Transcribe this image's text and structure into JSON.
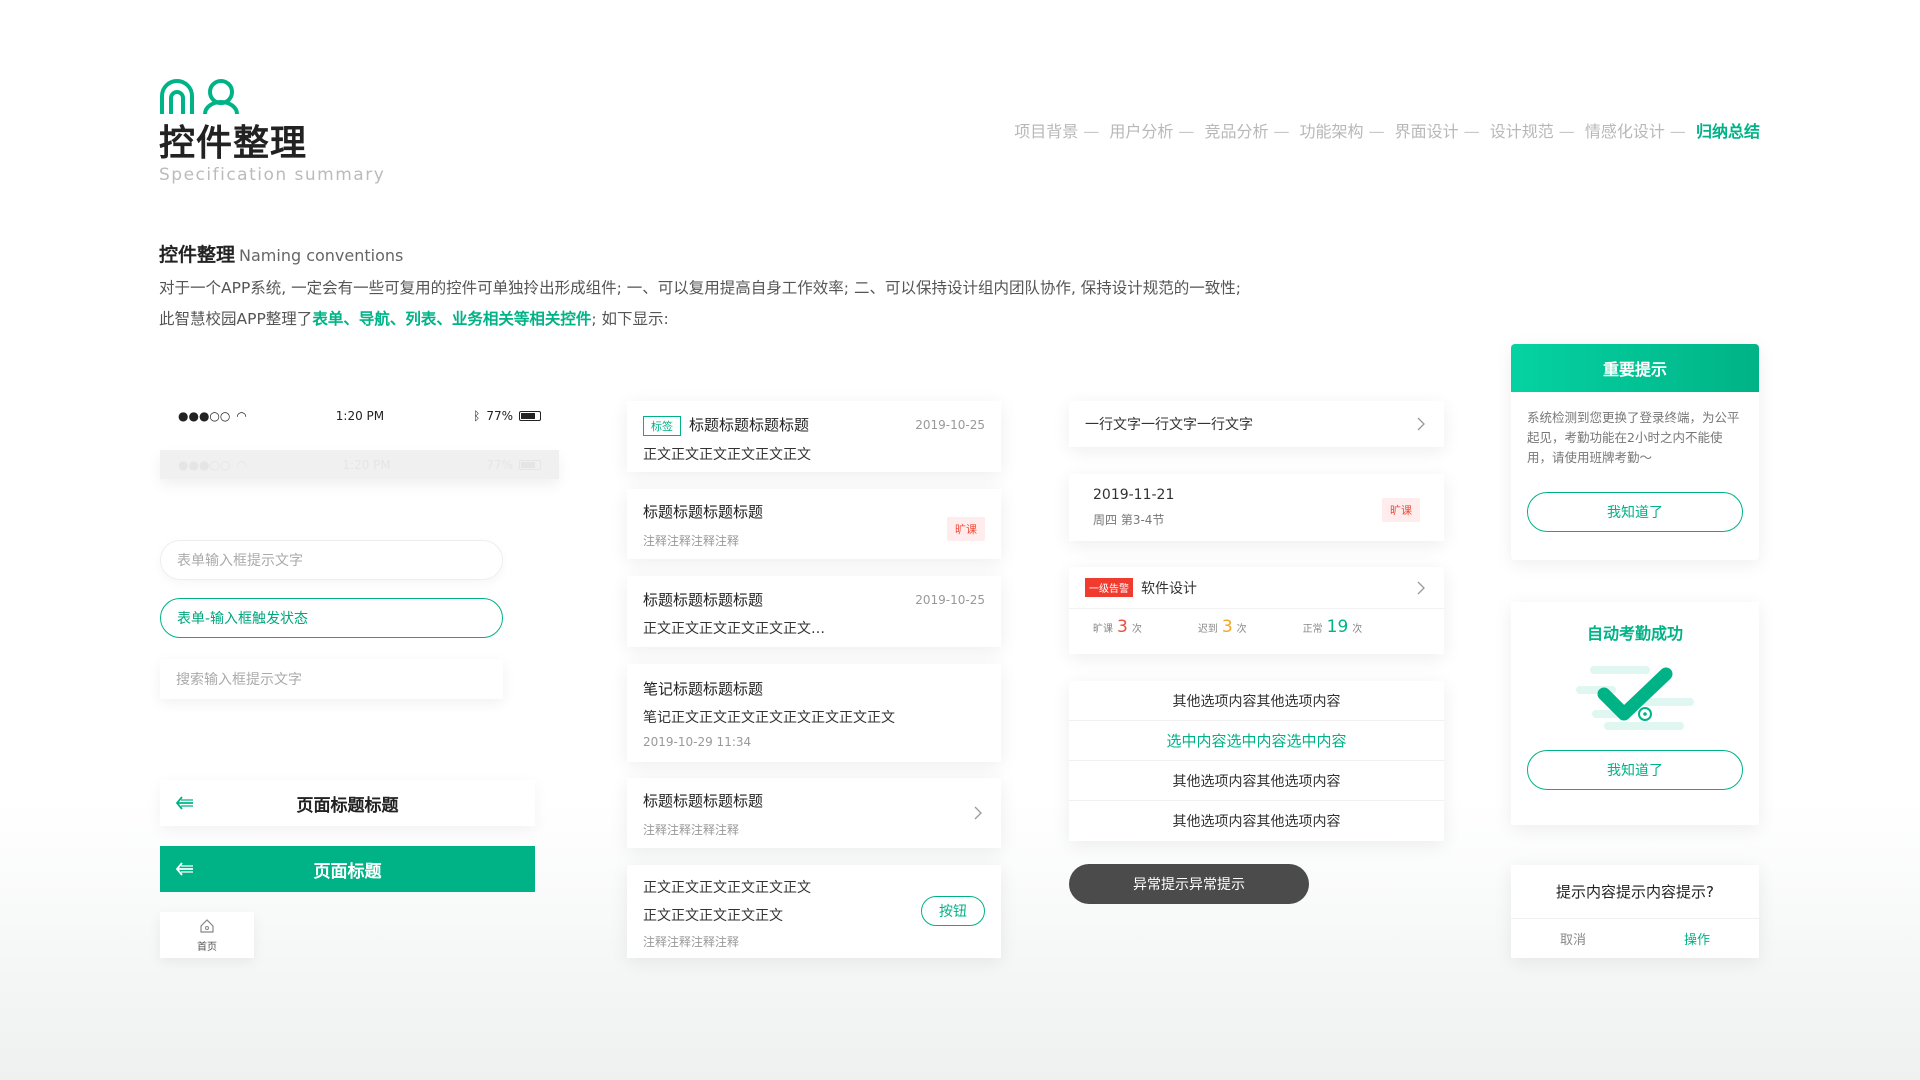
{
  "header": {
    "title": "控件整理",
    "subtitle": "Specification summary",
    "nav": [
      "项目背景",
      "用户分析",
      "竞品分析",
      "功能架构",
      "界面设计",
      "设计规范",
      "情感化设计"
    ],
    "nav_active": "归纳总结",
    "nav_separator": "—"
  },
  "section": {
    "title": "控件整理",
    "title_en": "Naming conventions",
    "desc_line1": "对于一个APP系统, 一定会有一些可复用的控件可单独拎出形成组件; 一、可以复用提高自身工作效率; 二、可以保持设计组内团队协作, 保持设计规范的一致性;",
    "desc_line2_prefix": "此智慧校园APP整理了",
    "desc_line2_highlight": "表单、导航、列表、业务相关等相关控件",
    "desc_line2_suffix": "; 如下显示:"
  },
  "status_bar": {
    "signal": "●●●○○",
    "time": "1:20 PM",
    "battery": "77%"
  },
  "inputs": {
    "placeholder": "表单输入框提示文字",
    "active_value": "表单-输入框触发状态",
    "search_placeholder": "搜索输入框提示文字"
  },
  "navbars": {
    "white_title": "页面标题标题",
    "green_title": "页面标题"
  },
  "tabbar": {
    "home_label": "首页"
  },
  "list_cards": {
    "c1": {
      "tag": "标签",
      "title": "标题标题标题标题",
      "date": "2019-10-25",
      "body": "正文正文正文正文正文正文"
    },
    "c2": {
      "title": "标题标题标题标题",
      "note": "注释注释注释注释",
      "badge": "旷课"
    },
    "c3": {
      "title": "标题标题标题标题",
      "date": "2019-10-25",
      "body": "正文正文正文正文正文正文…"
    },
    "c4": {
      "title": "笔记标题标题标题",
      "body": "笔记正文正文正文正文正文正文正文正文",
      "time": "2019-10-29 11:34"
    },
    "c5": {
      "title": "标题标题标题标题",
      "note": "注释注释注释注释"
    },
    "c6": {
      "line1": "正文正文正文正文正文正文",
      "line2": "正文正文正文正文正文",
      "note": "注释注释注释注释",
      "button": "按钮"
    }
  },
  "right_cards": {
    "single_line": "一行文字一行文字一行文字",
    "date_card": {
      "date": "2019-11-21",
      "sub": "周四   第3-4节",
      "badge": "旷课"
    },
    "alarm_card": {
      "alarm": "一级告警",
      "course": "软件设计",
      "stats": [
        {
          "label": "旷课",
          "value": "3",
          "unit": "次",
          "color": "#f04c3a"
        },
        {
          "label": "迟到",
          "value": "3",
          "unit": "次",
          "color": "#f5a623"
        },
        {
          "label": "正常",
          "value": "19",
          "unit": "次",
          "color": "#00b386"
        }
      ]
    },
    "options": [
      "其他选项内容其他选项内容",
      "选中内容选中内容选中内容",
      "其他选项内容其他选项内容",
      "其他选项内容其他选项内容"
    ],
    "toast": "异常提示异常提示"
  },
  "dialogs": {
    "important": {
      "title": "重要提示",
      "text": "系统检测到您更换了登录终端，为公平起见，考勤功能在2小时之内不能使用，请使用班牌考勤～",
      "button": "我知道了"
    },
    "success": {
      "title": "自动考勤成功",
      "button": "我知道了"
    },
    "confirm": {
      "text": "提示内容提示内容提示?",
      "cancel": "取消",
      "action": "操作"
    }
  },
  "colors": {
    "accent": "#00b386",
    "danger": "#f04c3a",
    "warning": "#f5a623"
  }
}
